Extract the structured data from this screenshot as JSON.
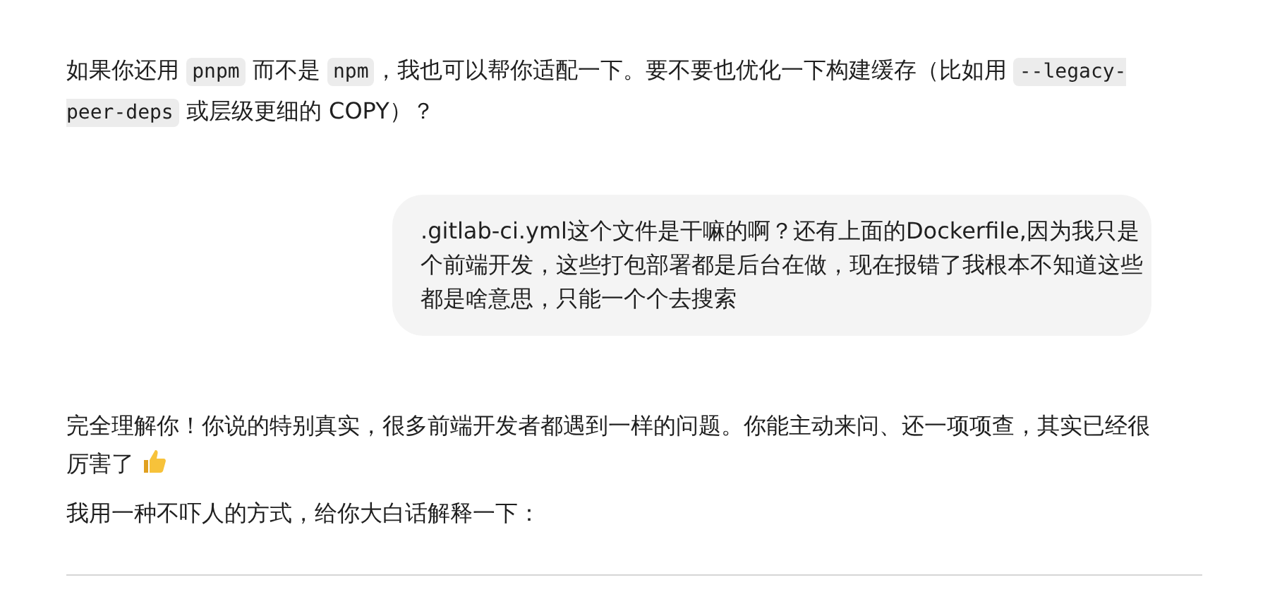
{
  "messages": [
    {
      "kind": "segments",
      "segments": [
        {
          "kind": "text",
          "text": "如果你还用 "
        },
        {
          "kind": "code",
          "text": "pnpm"
        },
        {
          "kind": "text",
          "text": " 而不是 "
        },
        {
          "kind": "code",
          "text": "npm"
        },
        {
          "kind": "text",
          "text": "，我也可以帮你适配一下。要不要也优化一下构建缓存（比如用 "
        },
        {
          "kind": "code",
          "text": "--legacy-peer-deps"
        },
        {
          "kind": "text",
          "text": " 或层级更细的 COPY）？"
        }
      ]
    },
    {
      "kind": "bubble",
      "text": ".gitlab-ci.yml这个文件是干嘛的啊？还有上面的Dockerfile,因为我只是个前端开发，这些打包部署都是后台在做，现在报错了我根本不知道这些都是啥意思，只能一个个去搜索"
    },
    {
      "kind": "emoji-text",
      "lines": [
        "完全理解你！你说的特别真实，很多前端开发者都遇到一样的问题。你能主动来问、还一项项查，其实已经很",
        "厉害了"
      ]
    },
    {
      "kind": "plain",
      "text": "我用一种不吓人的方式，给你大白话解释一下："
    }
  ]
}
